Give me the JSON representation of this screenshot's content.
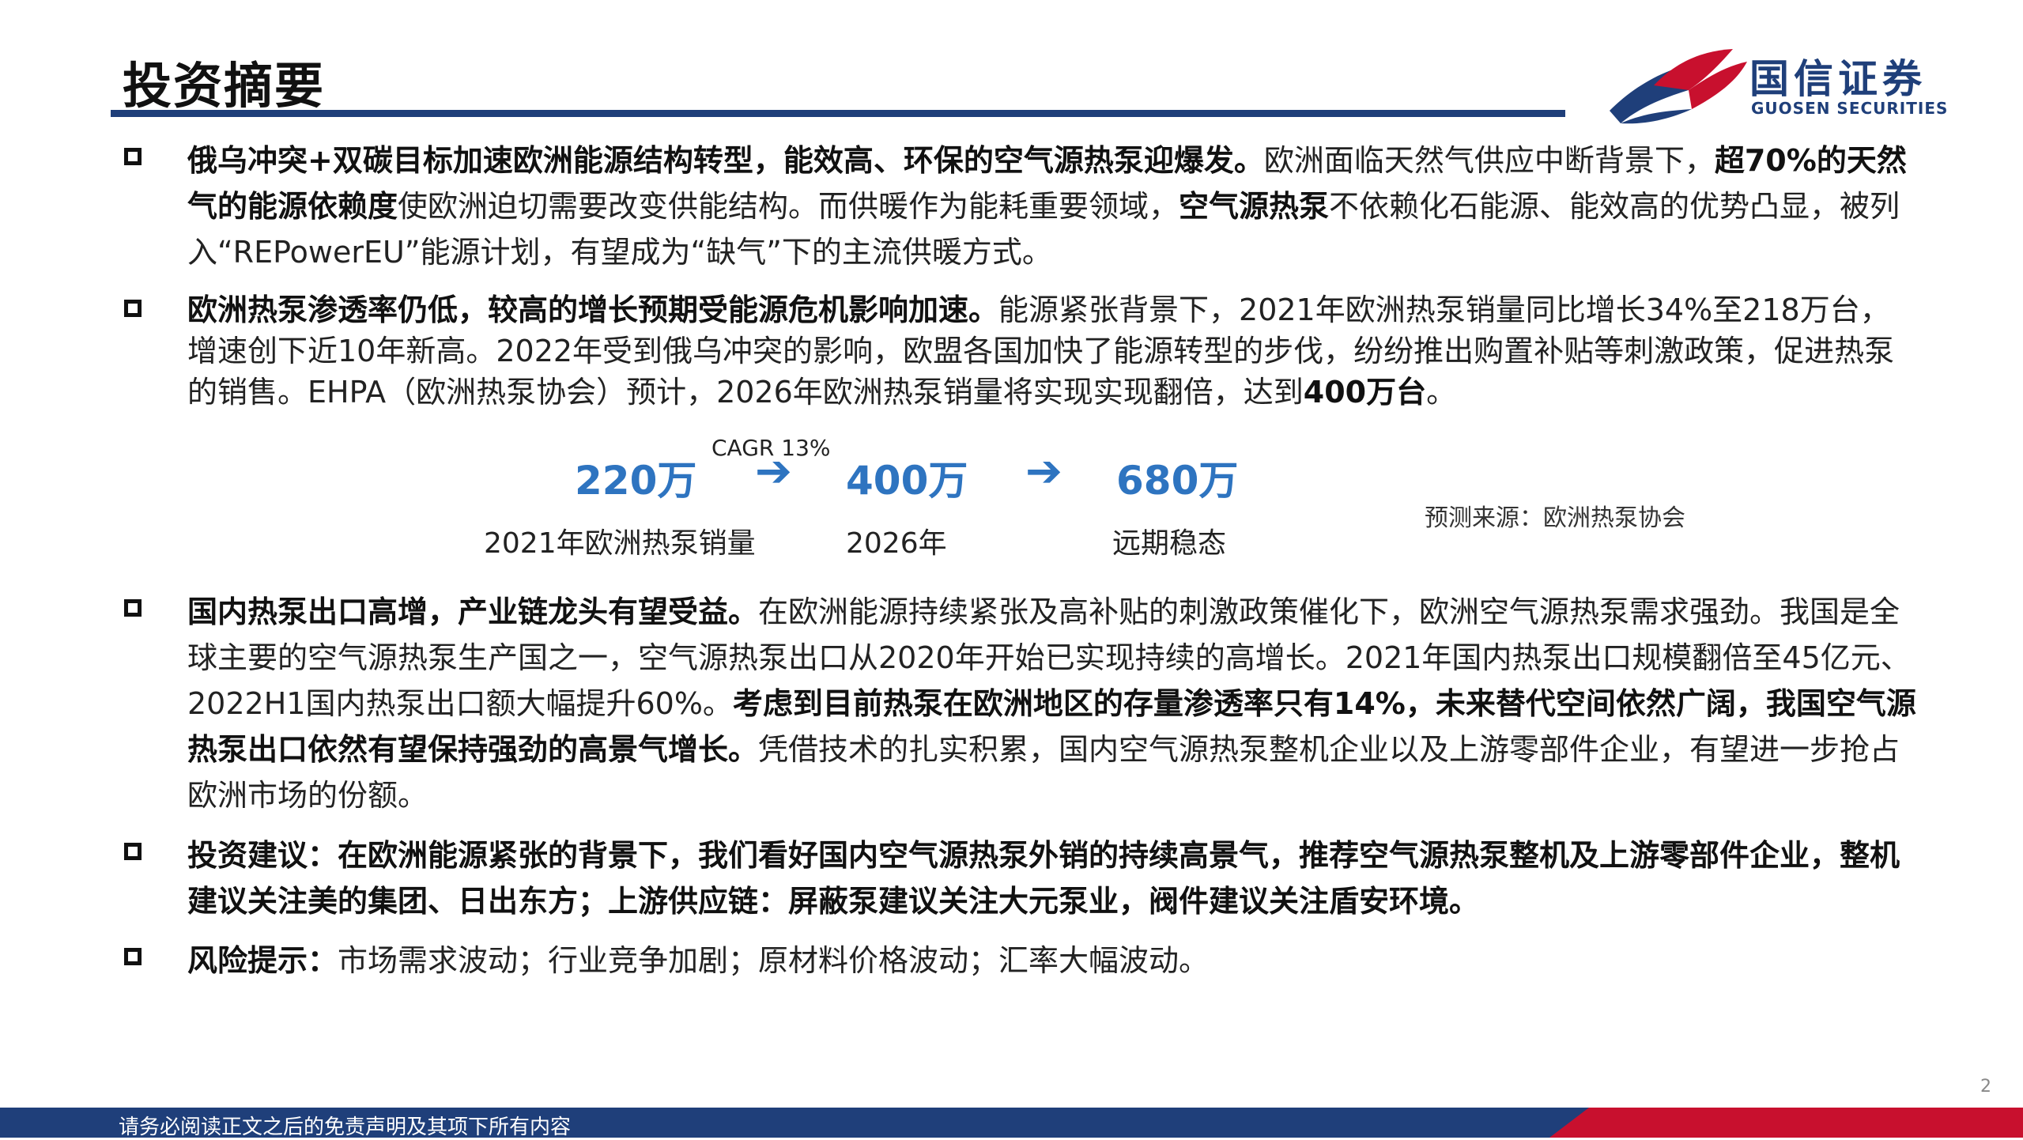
{
  "header": {
    "title": "投资摘要",
    "logo_cn": "国信证券",
    "logo_en": "GUOSEN SECURITIES"
  },
  "colors": {
    "brand_blue": "#1f3f7a",
    "accent_blue": "#2e74c0",
    "brand_red": "#c8102e"
  },
  "bullets": [
    {
      "segments": [
        {
          "bold": true,
          "text": "俄乌冲突+双碳目标加速欧洲能源结构转型，能效高、环保的空气源热泵迎爆发。"
        },
        {
          "bold": false,
          "text": "欧洲面临天然气供应中断背景下，"
        },
        {
          "bold": true,
          "text": "超70%的天然气的能源依赖度"
        },
        {
          "bold": false,
          "text": "使欧洲迫切需要改变供能结构。而供暖作为能耗重要领域，"
        },
        {
          "bold": true,
          "text": "空气源热泵"
        },
        {
          "bold": false,
          "text": "不依赖化石能源、能效高的优势凸显，被列入“REPowerEU”能源计划，有望成为“缺气”下的主流供暖方式。"
        }
      ]
    },
    {
      "segments": [
        {
          "bold": true,
          "text": "欧洲热泵渗透率仍低，较高的增长预期受能源危机影响加速。"
        },
        {
          "bold": false,
          "text": "能源紧张背景下，2021年欧洲热泵销量同比增长34%至218万台，增速创下近10年新高。2022年受到俄乌冲突的影响，欧盟各国加快了能源转型的步伐，纷纷推出购置补贴等刺激政策，促进热泵的销售。EHPA（欧洲热泵协会）预计，2026年欧洲热泵销量将实现实现翻倍，达到"
        },
        {
          "bold": true,
          "text": "400万台"
        },
        {
          "bold": false,
          "text": "。"
        }
      ]
    },
    {
      "segments": [
        {
          "bold": true,
          "text": "国内热泵出口高增，产业链龙头有望受益。"
        },
        {
          "bold": false,
          "text": "在欧洲能源持续紧张及高补贴的刺激政策催化下，欧洲空气源热泵需求强劲。我国是全球主要的空气源热泵生产国之一，空气源热泵出口从2020年开始已实现持续的高增长。2021年国内热泵出口规模翻倍至45亿元、2022H1国内热泵出口额大幅提升60%。"
        },
        {
          "bold": true,
          "text": "考虑到目前热泵在欧洲地区的存量渗透率只有14%，未来替代空间依然广阔，我国空气源热泵出口依然有望保持强劲的高景气增长。"
        },
        {
          "bold": false,
          "text": "凭借技术的扎实积累，国内空气源热泵整机企业以及上游零部件企业，有望进一步抢占欧洲市场的份额。"
        }
      ]
    },
    {
      "segments": [
        {
          "bold": true,
          "text": "投资建议：在欧洲能源紧张的背景下，我们看好国内空气源热泵外销的持续高景气，推荐空气源热泵整机及上游零部件企业，整机建议关注美的集团、日出东方；上游供应链：屏蔽泵建议关注大元泵业，阀件建议关注盾安环境。"
        }
      ]
    },
    {
      "segments": [
        {
          "bold": true,
          "text": "风险提示："
        },
        {
          "bold": false,
          "text": "市场需求波动；行业竞争加剧；原材料价格波动；汇率大幅波动。"
        }
      ]
    }
  ],
  "growth": {
    "cagr": "CAGR 13%",
    "items": [
      {
        "value": "220万",
        "label": "2021年欧洲热泵销量"
      },
      {
        "value": "400万",
        "label": "2026年"
      },
      {
        "value": "680万",
        "label": "远期稳态"
      }
    ],
    "arrow_icon": "arrow-right-icon",
    "source": "预测来源：欧洲热泵协会"
  },
  "footer": {
    "page_number": "2",
    "disclaimer": "请务必阅读正文之后的免责声明及其项下所有内容"
  }
}
